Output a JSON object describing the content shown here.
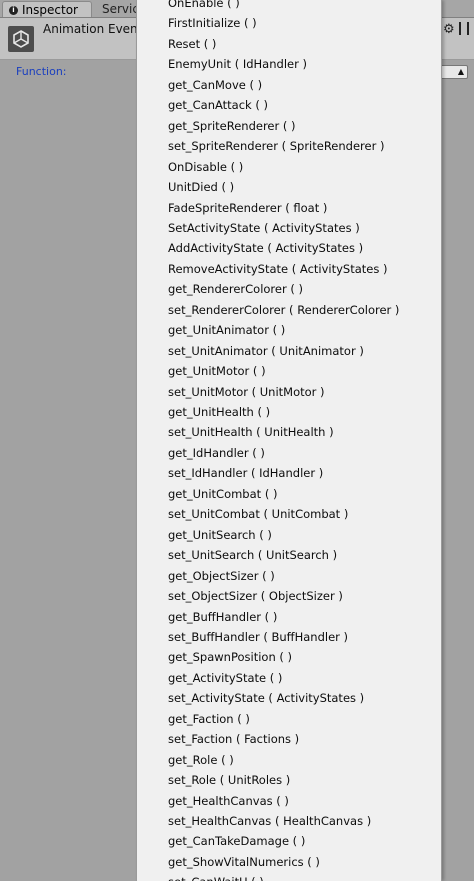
{
  "tabs": [
    {
      "label": "Inspector",
      "icon": "info-icon"
    },
    {
      "label": "Servic"
    }
  ],
  "header": {
    "title": "Animation Event",
    "icon": "unity-logo-icon"
  },
  "function_field": {
    "label": "Function:"
  },
  "menu": {
    "items": [
      "OnEnable ( )",
      "FirstInitialize ( )",
      "Reset ( )",
      "EnemyUnit ( IdHandler )",
      "get_CanMove ( )",
      "get_CanAttack ( )",
      "get_SpriteRenderer ( )",
      "set_SpriteRenderer ( SpriteRenderer )",
      "OnDisable ( )",
      "UnitDied ( )",
      "FadeSpriteRenderer ( float )",
      "SetActivityState ( ActivityStates )",
      "AddActivityState ( ActivityStates )",
      "RemoveActivityState ( ActivityStates )",
      "get_RendererColorer ( )",
      "set_RendererColorer ( RendererColorer )",
      "get_UnitAnimator ( )",
      "set_UnitAnimator ( UnitAnimator )",
      "get_UnitMotor ( )",
      "set_UnitMotor ( UnitMotor )",
      "get_UnitHealth ( )",
      "set_UnitHealth ( UnitHealth )",
      "get_IdHandler ( )",
      "set_IdHandler ( IdHandler )",
      "get_UnitCombat ( )",
      "set_UnitCombat ( UnitCombat )",
      "get_UnitSearch ( )",
      "set_UnitSearch ( UnitSearch )",
      "get_ObjectSizer ( )",
      "set_ObjectSizer ( ObjectSizer )",
      "get_BuffHandler ( )",
      "set_BuffHandler ( BuffHandler )",
      "get_SpawnPosition ( )",
      "get_ActivityState ( )",
      "set_ActivityState ( ActivityStates )",
      "get_Faction ( )",
      "set_Faction ( Factions )",
      "get_Role ( )",
      "set_Role ( UnitRoles )",
      "get_HealthCanvas ( )",
      "set_HealthCanvas ( HealthCanvas )",
      "get_CanTakeDamage ( )",
      "get_ShowVitalNumerics ( )",
      "set_CanWaitU ( )"
    ]
  }
}
